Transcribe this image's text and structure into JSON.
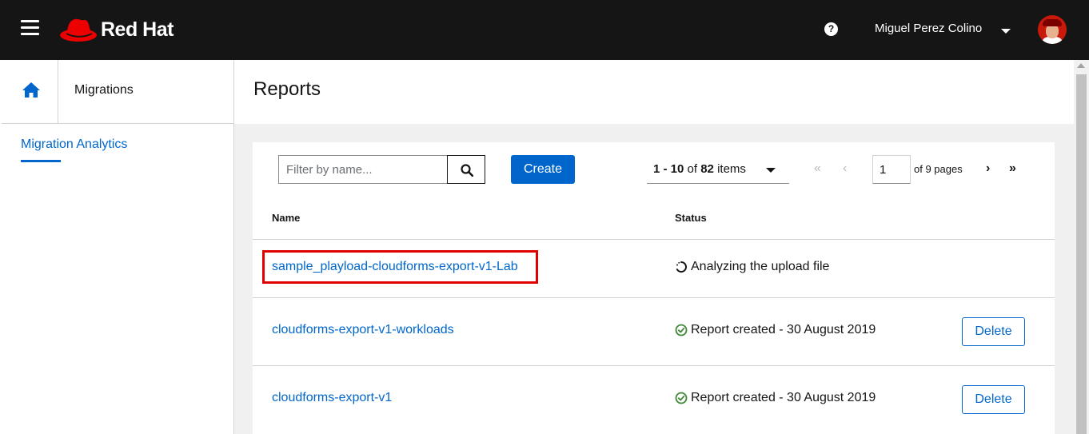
{
  "header": {
    "brand": "Red Hat",
    "help_icon": "question-circle-icon",
    "user_name": "Miguel Perez Colino"
  },
  "sidebar": {
    "home_icon": "home-icon",
    "section_label": "Migrations",
    "nav_item": "Migration Analytics"
  },
  "page": {
    "title": "Reports"
  },
  "toolbar": {
    "filter_placeholder": "Filter by name...",
    "create_label": "Create",
    "per_page_range": "1 - 10",
    "per_page_of": "of",
    "per_page_total": "82",
    "per_page_items": "items",
    "page_value": "1",
    "of_pages": "of 9 pages"
  },
  "table": {
    "columns": [
      "Name",
      "Status"
    ],
    "rows": [
      {
        "name": "sample_playload-cloudforms-export-v1-Lab",
        "status": "Analyzing the upload file",
        "status_icon": "spinner-icon",
        "has_delete": false
      },
      {
        "name": "cloudforms-export-v1-workloads",
        "status": "Report created - 30 August 2019",
        "status_icon": "check-circle-icon",
        "has_delete": true,
        "delete_label": "Delete"
      },
      {
        "name": "cloudforms-export-v1",
        "status": "Report created - 30 August 2019",
        "status_icon": "check-circle-icon",
        "has_delete": true,
        "delete_label": "Delete"
      }
    ]
  },
  "colors": {
    "topbar": "#151515",
    "link": "#0066cc",
    "success": "#3e8635",
    "highlight": "#e00000",
    "brand_red": "#ee0000"
  }
}
